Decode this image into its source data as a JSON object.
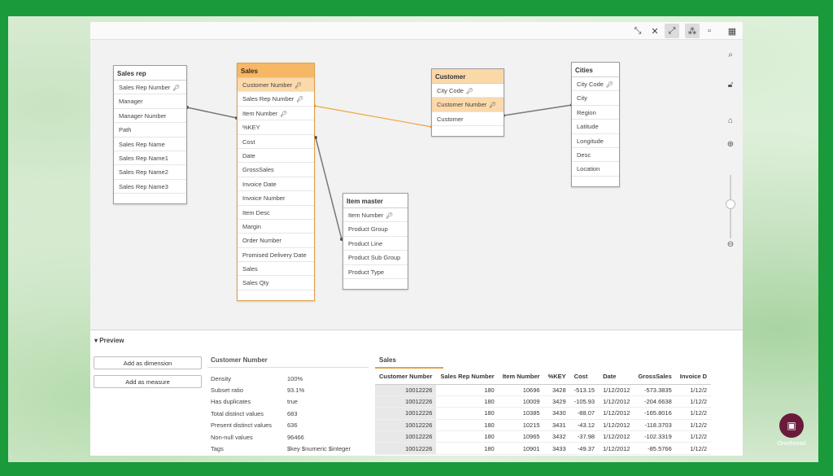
{
  "toolbar": {
    "icons": [
      "collapse-all-icon",
      "expand-links-icon",
      "shrink-icon",
      "show-associations-icon",
      "layout-icon",
      "grid-view-icon"
    ]
  },
  "tables": {
    "sales_rep": {
      "title": "Sales rep",
      "fields": [
        {
          "name": "Sales Rep Number",
          "key": true
        },
        {
          "name": "Manager",
          "key": false
        },
        {
          "name": "Manager Number",
          "key": false
        },
        {
          "name": "Path",
          "key": false
        },
        {
          "name": "Sales Rep Name",
          "key": false
        },
        {
          "name": "Sales Rep Name1",
          "key": false
        },
        {
          "name": "Sales Rep Name2",
          "key": false
        },
        {
          "name": "Sales Rep Name3",
          "key": false
        }
      ]
    },
    "sales": {
      "title": "Sales",
      "fields": [
        {
          "name": "Customer Number",
          "key": true
        },
        {
          "name": "Sales Rep Number",
          "key": true
        },
        {
          "name": "Item Number",
          "key": true
        },
        {
          "name": "%KEY",
          "key": false
        },
        {
          "name": "Cost",
          "key": false
        },
        {
          "name": "Date",
          "key": false
        },
        {
          "name": "GrossSales",
          "key": false
        },
        {
          "name": "Invoice Date",
          "key": false
        },
        {
          "name": "Invoice Number",
          "key": false
        },
        {
          "name": "Item Desc",
          "key": false
        },
        {
          "name": "Margin",
          "key": false
        },
        {
          "name": "Order Number",
          "key": false
        },
        {
          "name": "Promised Delivery Date",
          "key": false
        },
        {
          "name": "Sales",
          "key": false
        },
        {
          "name": "Sales Qty",
          "key": false
        }
      ]
    },
    "customer": {
      "title": "Customer",
      "fields": [
        {
          "name": "City Code",
          "key": true
        },
        {
          "name": "Customer Number",
          "key": true
        },
        {
          "name": "Customer",
          "key": false
        }
      ]
    },
    "cities": {
      "title": "Cities",
      "fields": [
        {
          "name": "City Code",
          "key": true
        },
        {
          "name": "City",
          "key": false
        },
        {
          "name": "Region",
          "key": false
        },
        {
          "name": "Latitude",
          "key": false
        },
        {
          "name": "Longitude",
          "key": false
        },
        {
          "name": "Desc",
          "key": false
        },
        {
          "name": "Location",
          "key": false
        }
      ]
    },
    "item_master": {
      "title": "Item master",
      "fields": [
        {
          "name": "Item Number",
          "key": true
        },
        {
          "name": "Product Group",
          "key": false
        },
        {
          "name": "Product Line",
          "key": false
        },
        {
          "name": "Product Sub Group",
          "key": false
        },
        {
          "name": "Product Type",
          "key": false
        }
      ]
    }
  },
  "preview": {
    "heading": "Preview",
    "add_dimension": "Add as dimension",
    "add_measure": "Add as measure",
    "field_title": "Customer Number",
    "stats": [
      {
        "label": "Density",
        "value": "100%"
      },
      {
        "label": "Subset ratio",
        "value": "93.1%"
      },
      {
        "label": "Has duplicates",
        "value": "true"
      },
      {
        "label": "Total distinct values",
        "value": "683"
      },
      {
        "label": "Present distinct values",
        "value": "636"
      },
      {
        "label": "Non-null values",
        "value": "96466"
      },
      {
        "label": "Tags",
        "value": "$key $numeric $integer"
      }
    ],
    "table_title": "Sales",
    "columns": [
      "Customer Number",
      "Sales Rep Number",
      "Item Number",
      "%KEY",
      "Cost",
      "Date",
      "GrossSales",
      "Invoice D"
    ],
    "rows": [
      [
        "10012226",
        "180",
        "10696",
        "3428",
        "-513.15",
        "1/12/2012",
        "-573.3835",
        "1/12/2"
      ],
      [
        "10012226",
        "180",
        "10009",
        "3429",
        "-105.93",
        "1/12/2012",
        "-204.6638",
        "1/12/2"
      ],
      [
        "10012226",
        "180",
        "10385",
        "3430",
        "-88.07",
        "1/12/2012",
        "-165.8016",
        "1/12/2"
      ],
      [
        "10012226",
        "180",
        "10215",
        "3431",
        "-43.12",
        "1/12/2012",
        "-118.3703",
        "1/12/2"
      ],
      [
        "10012226",
        "180",
        "10965",
        "3432",
        "-37.98",
        "1/12/2012",
        "-102.3319",
        "1/12/2"
      ],
      [
        "10012226",
        "180",
        "10901",
        "3433",
        "-49.37",
        "1/12/2012",
        "-85.5766",
        "1/12/2"
      ]
    ]
  },
  "brand": {
    "name": "Onethread"
  },
  "colors": {
    "selected_header": "#f6b865",
    "associated_field": "#fbd9ab",
    "frame": "#1a9a3a"
  }
}
